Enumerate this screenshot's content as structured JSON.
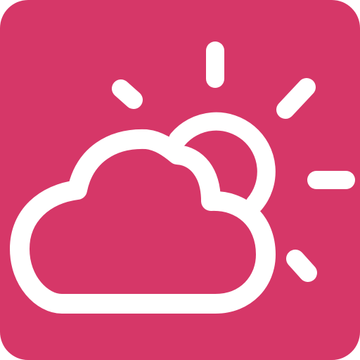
{
  "icon": {
    "name": "partly-cloudy-weather-icon",
    "background_color": "#D63768",
    "glyph_color": "#FFFFFF"
  }
}
